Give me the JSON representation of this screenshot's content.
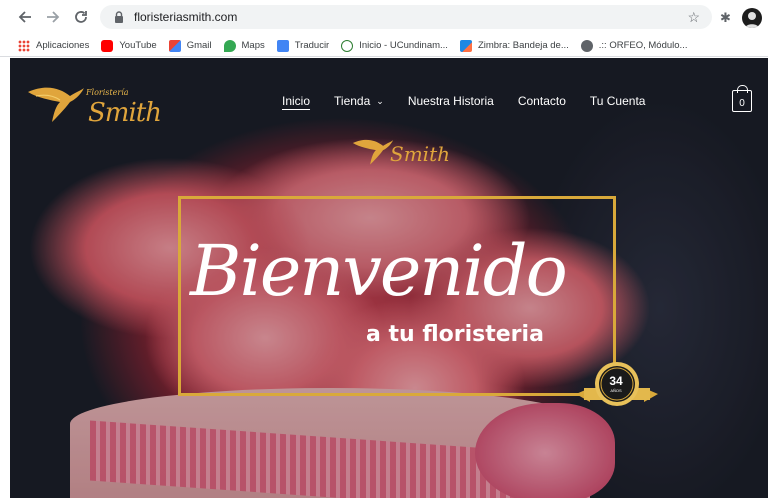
{
  "browser": {
    "url": "floristeriasmith.com",
    "bookmarks": [
      {
        "label": "Aplicaciones",
        "icon": "apps-grid-icon",
        "color": "#4285f4"
      },
      {
        "label": "YouTube",
        "icon": "youtube-icon",
        "color": "#ff0000"
      },
      {
        "label": "Gmail",
        "icon": "gmail-icon",
        "color": "#ea4335"
      },
      {
        "label": "Maps",
        "icon": "maps-pin-icon",
        "color": "#34a853"
      },
      {
        "label": "Traducir",
        "icon": "translate-icon",
        "color": "#4285f4"
      },
      {
        "label": "Inicio - UCundinam...",
        "icon": "site-icon",
        "color": "#2e7d32"
      },
      {
        "label": "Zimbra: Bandeja de...",
        "icon": "zimbra-icon",
        "color": "#1e88e5"
      },
      {
        "label": ".:: ORFEO, Módulo...",
        "icon": "globe-icon",
        "color": "#5f6368"
      }
    ]
  },
  "site": {
    "logo": {
      "small_text": "Floristería",
      "name": "Smith"
    },
    "nav": [
      "Inicio",
      "Tienda",
      "Nuestra Historia",
      "Contacto",
      "Tu Cuenta"
    ],
    "cart_count": "0",
    "hero": {
      "center_logo_name": "Smith",
      "script_title": "Bienvenido",
      "subtitle": "a tu floristeria",
      "seal_years": "34",
      "seal_caption": "AÑOS"
    },
    "colors": {
      "gold": "#d9a93a",
      "white": "#ffffff"
    }
  }
}
